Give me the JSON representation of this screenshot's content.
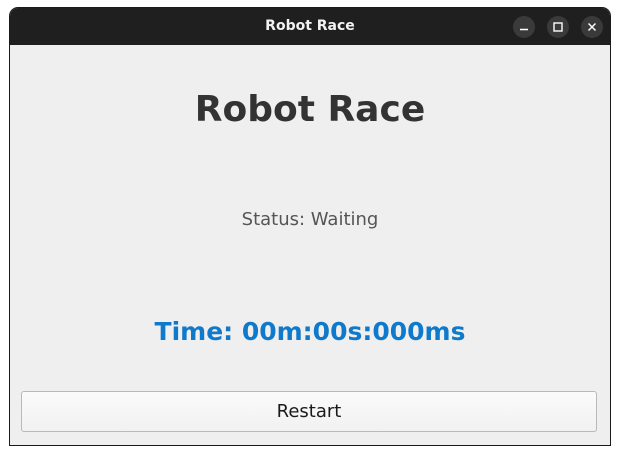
{
  "window": {
    "title": "Robot Race",
    "controls": {
      "minimize_icon": "minimize-icon",
      "maximize_icon": "maximize-icon",
      "close_icon": "close-icon"
    }
  },
  "main": {
    "heading": "Robot Race",
    "status": "Status: Waiting",
    "timer": "Time: 00m:00s:000ms",
    "restart_label": "Restart"
  },
  "colors": {
    "titlebar": "#1f1f1f",
    "background": "#efefef",
    "heading": "#333333",
    "status": "#555555",
    "timer": "#0f7acc"
  }
}
